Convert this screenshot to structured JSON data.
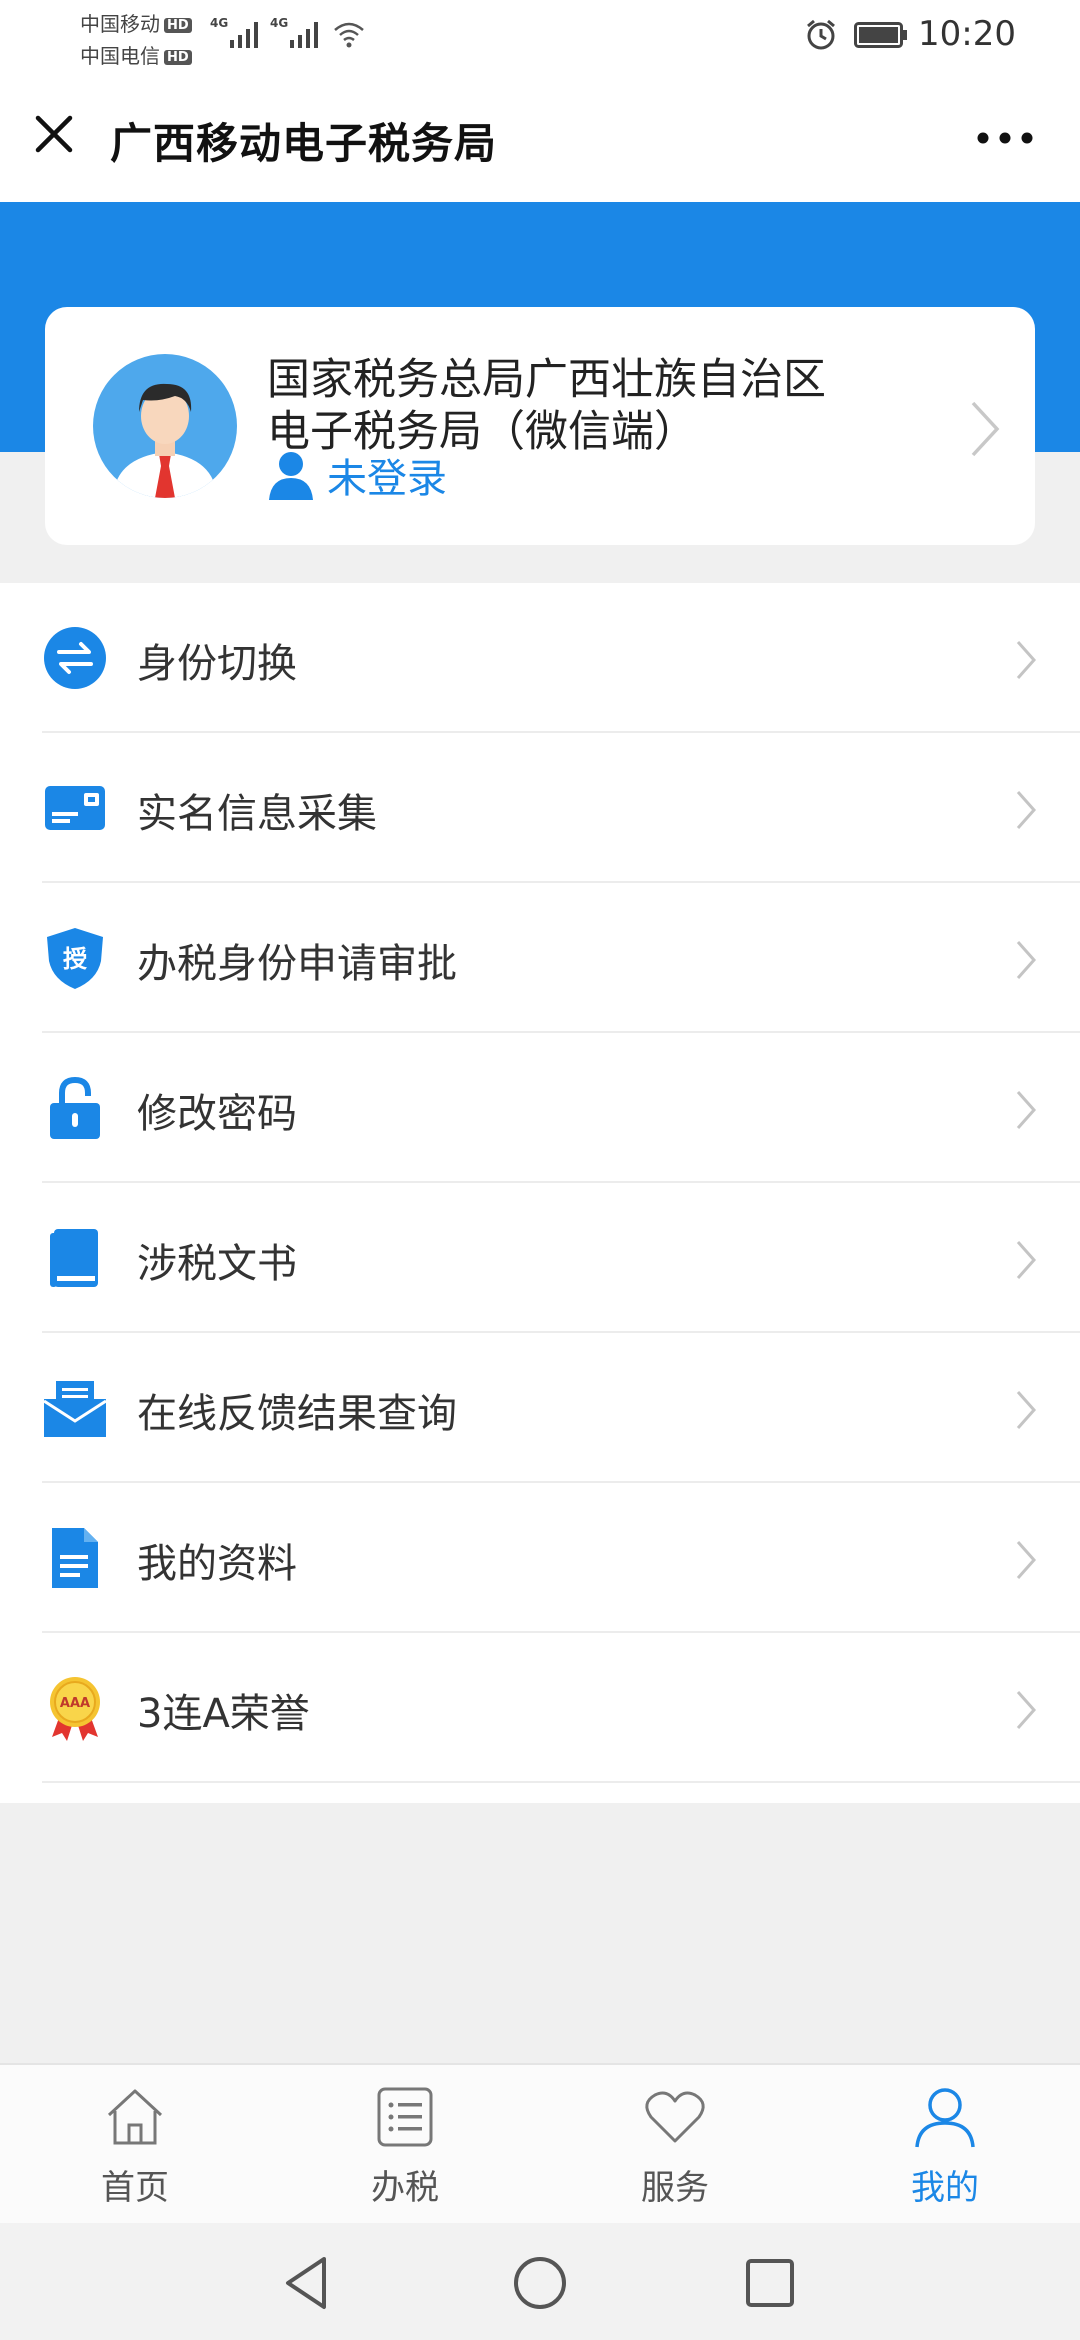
{
  "status_bar": {
    "carrier1": "中国移动",
    "carrier2": "中国电信",
    "hd_badge": "HD",
    "network_tag": "4G",
    "time": "10:20"
  },
  "title_bar": {
    "title": "广西移动电子税务局",
    "close_icon": "close-icon",
    "more_icon": "more-icon"
  },
  "profile": {
    "org_line1": "国家税务总局广西壮族自治区",
    "org_line2": "电子税务局（微信端）",
    "login_status": "未登录"
  },
  "menu": {
    "items": [
      {
        "label": "身份切换",
        "icon": "switch-identity-icon"
      },
      {
        "label": "实名信息采集",
        "icon": "id-card-icon"
      },
      {
        "label": "办税身份申请审批",
        "icon": "shield-authorize-icon"
      },
      {
        "label": "修改密码",
        "icon": "lock-icon"
      },
      {
        "label": "涉税文书",
        "icon": "book-icon"
      },
      {
        "label": "在线反馈结果查询",
        "icon": "mail-icon"
      },
      {
        "label": "我的资料",
        "icon": "document-icon"
      },
      {
        "label": "3连A荣誉",
        "icon": "medal-icon"
      }
    ],
    "shield_glyph": "授",
    "medal_text": "AAA"
  },
  "tab_bar": {
    "tabs": [
      {
        "label": "首页",
        "icon": "home-icon",
        "active": false
      },
      {
        "label": "办税",
        "icon": "list-icon",
        "active": false
      },
      {
        "label": "服务",
        "icon": "heart-icon",
        "active": false
      },
      {
        "label": "我的",
        "icon": "person-icon",
        "active": true
      }
    ]
  },
  "colors": {
    "brand_blue": "#1b87e6",
    "background": "#f0f0f0"
  }
}
